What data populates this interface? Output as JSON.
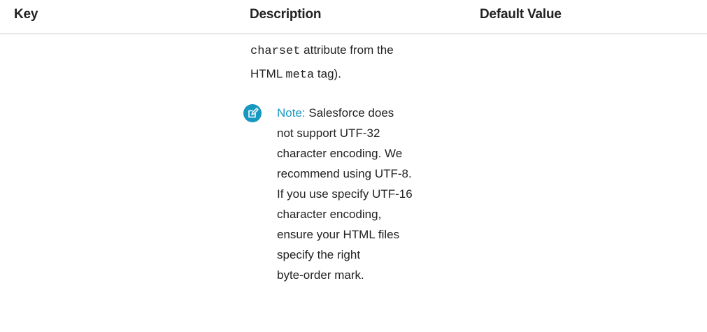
{
  "table": {
    "headers": {
      "key": "Key",
      "description": "Description",
      "default_value": "Default Value"
    }
  },
  "description": {
    "line1_code": "charset",
    "line1_text": " attribute from the",
    "line2_text_a": "HTML ",
    "line2_code": "meta",
    "line2_text_b": " tag)."
  },
  "note": {
    "icon": "edit-note-icon",
    "label": "Note:",
    "lines": [
      " Salesforce does",
      "not support UTF-32",
      "character encoding. We",
      "recommend using UTF-8.",
      "If you use specify UTF-16",
      "character encoding,",
      "ensure your HTML files",
      "specify the right",
      "byte-order mark."
    ]
  },
  "colors": {
    "note_accent": "#1798c1",
    "rule": "#c9c9c9"
  }
}
